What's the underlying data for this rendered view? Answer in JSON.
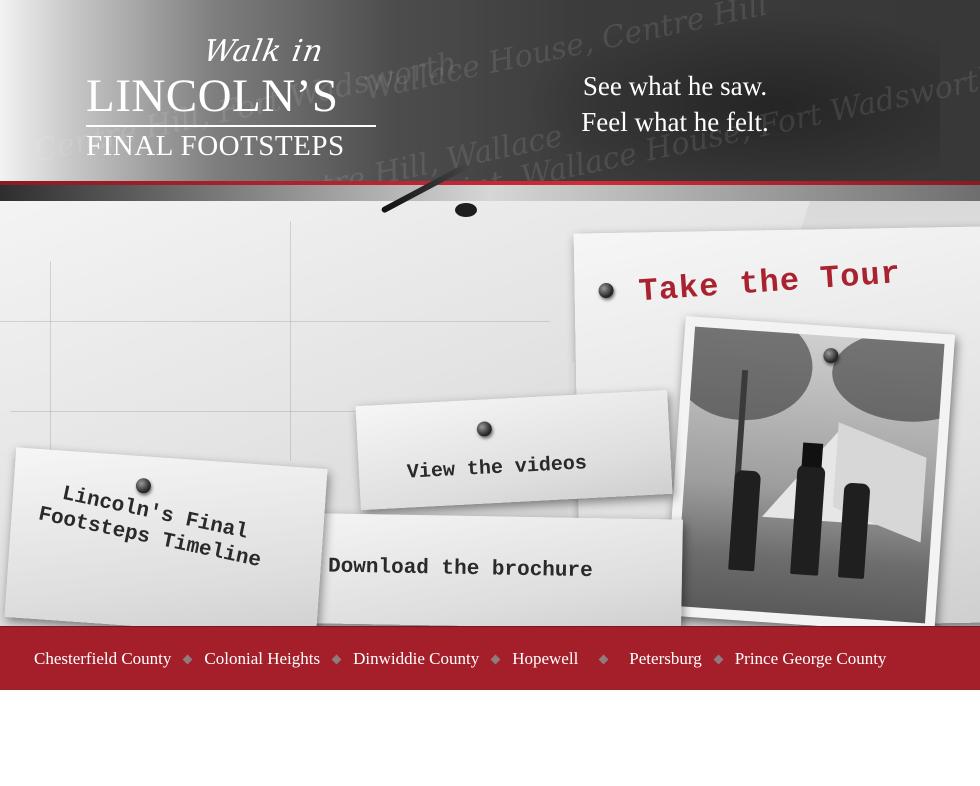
{
  "header": {
    "logo": {
      "walk_in": "Walk in",
      "lincolns": "LINCOLN’S",
      "final_footsteps": "FINAL FOOTSTEPS"
    },
    "tagline_line1": "See what he saw.",
    "tagline_line2": "Feel what he felt."
  },
  "cards": {
    "tour": "Take the Tour",
    "videos": "View the videos",
    "brochure": "Download the brochure",
    "timeline": "Lincoln's Final Footsteps Timeline"
  },
  "nav": {
    "items": [
      "Chesterfield County",
      "Colonial Heights",
      "Dinwiddie County",
      "Hopewell",
      "Petersburg",
      "Prince George County"
    ]
  },
  "colors": {
    "accent_red": "#a51f2b",
    "tour_label_red": "#a8232f",
    "header_dark": "#3b3b3b"
  },
  "icons": [
    "nail-icon",
    "tack-icon",
    "diamond-separator-icon"
  ]
}
